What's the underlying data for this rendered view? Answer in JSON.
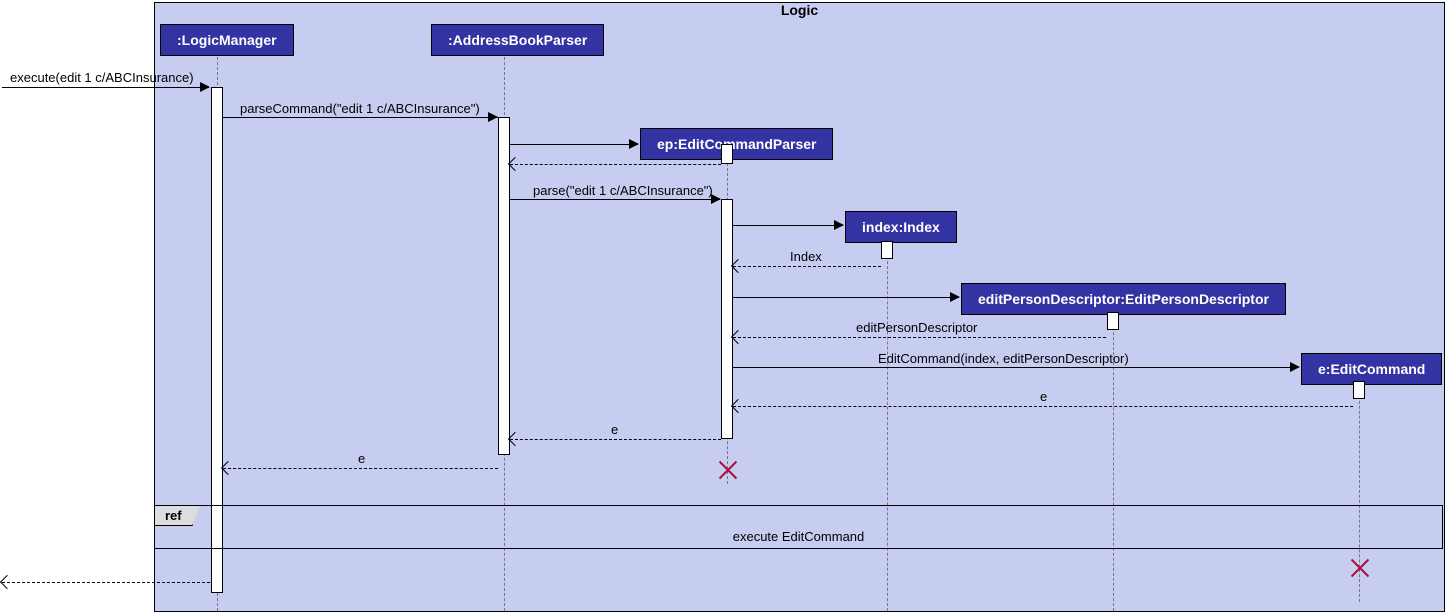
{
  "frame": {
    "title": "Logic"
  },
  "participants": {
    "logicManager": ":LogicManager",
    "addressBookParser": ":AddressBookParser",
    "editCommandParser": "ep:EditCommandParser",
    "index": "index:Index",
    "editPersonDescriptor": "editPersonDescriptor:EditPersonDescriptor",
    "editCommand": "e:EditCommand"
  },
  "messages": {
    "execute": "execute(edit 1 c/ABCInsurance)",
    "parseCommand": "parseCommand(\"edit 1 c/ABCInsurance\")",
    "parse": "parse(\"edit 1 c/ABCInsurance\")",
    "indexReturn": "Index",
    "epdReturn": "editPersonDescriptor",
    "editCmdCreate": "EditCommand(index, editPersonDescriptor)",
    "eReturn1": "e",
    "eReturn2": "e",
    "eReturn3": "e"
  },
  "ref": {
    "label": "ref",
    "text": "execute EditCommand"
  }
}
